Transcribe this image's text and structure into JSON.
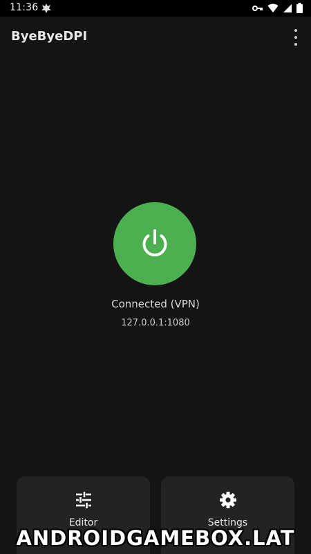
{
  "status_bar": {
    "time": "11:36",
    "icons": [
      "app-notification-icon",
      "vpn-key-icon",
      "wifi-icon",
      "signal-icon",
      "battery-icon"
    ]
  },
  "app_bar": {
    "title": "ByeByeDPI",
    "menu_icon": "more-vert-icon"
  },
  "main": {
    "power_icon": "power-icon",
    "power_color": "#4caf50",
    "status": "Connected (VPN)",
    "address": "127.0.0.1:1080"
  },
  "bottom_cards": {
    "editor": {
      "label": "Editor",
      "icon": "sliders-icon"
    },
    "settings": {
      "label": "Settings",
      "icon": "gear-icon"
    }
  },
  "watermark": "ANDROIDGAMEBOX.LAT"
}
